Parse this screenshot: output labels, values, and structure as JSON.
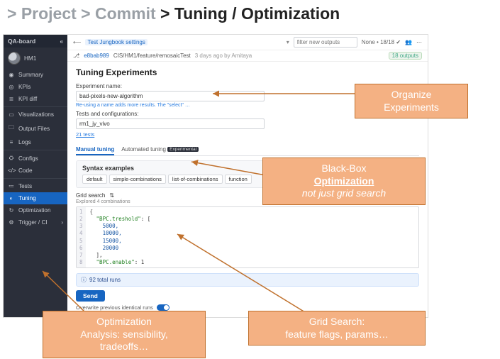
{
  "breadcrumb": {
    "dim": "> Project > Commit ",
    "strong": "> Tuning / Optimization"
  },
  "sidebar": {
    "brand": "QA-board",
    "project_label": "HM1",
    "items": [
      {
        "icon": "◉",
        "label": "Summary"
      },
      {
        "icon": "◎",
        "label": "KPIs"
      },
      {
        "icon": "≣",
        "label": "KPI diff"
      }
    ],
    "group2": [
      {
        "icon": "▭",
        "label": "Visualizations"
      },
      {
        "icon": "🗀",
        "label": "Output Files"
      },
      {
        "icon": "≡",
        "label": "Logs"
      }
    ],
    "group3": [
      {
        "icon": "⛭",
        "label": "Configs"
      },
      {
        "icon": "</>",
        "label": "Code"
      }
    ],
    "group4": [
      {
        "icon": "≔",
        "label": "Tests"
      },
      {
        "icon": "◐",
        "label": "Tuning"
      },
      {
        "icon": "↻",
        "label": "Optimization"
      },
      {
        "icon": "⚙",
        "label": "Trigger / CI"
      }
    ]
  },
  "topbar": {
    "prev_commit": "⟵",
    "jungbook": "Test Jungbook settings",
    "filter_placeholder": "filter new outputs",
    "status_counter": "None • 18/18 ✔",
    "commit_icon": "⎇",
    "commit_hash": "e8bab989",
    "commit_path": "CIS/HM1/feature/remosaicTest",
    "commit_meta": "3 days ago by Amitaya",
    "outputs_badge": "18 outputs"
  },
  "panel": {
    "title": "Tuning Experiments",
    "name_label": "Experiment name:",
    "name_value": "bad-pixels-new-algorithm",
    "name_hint": "Re-using a name adds more results. The \"select\" …",
    "tests_label": "Tests and configurations:",
    "tests_value": "rm1_jy_vivo",
    "tests_link": "21 tests",
    "tabs": {
      "manual": "Manual tuning",
      "automated": "Automated tuning",
      "badge": "Experimental"
    },
    "syntax": {
      "title": "Syntax examples",
      "buttons": [
        "default",
        "simple-combinations",
        "list-of-combinations",
        "function"
      ]
    },
    "gridsearch_label": "Grid search",
    "gridsearch_sort": "⇅",
    "explored": "Explored 4 combinations",
    "code": {
      "lines": [
        "1",
        "2",
        "3",
        "4",
        "5",
        "6",
        "7",
        "8"
      ],
      "l1": "{",
      "l2_key": "\"BPC.treshold\"",
      "l2_rest": ": [",
      "l3": "    5000,",
      "l4": "    10000,",
      "l5": "    15000,",
      "l6": "    20000",
      "l7": "  ],",
      "l8_key": "\"BPC.enable\"",
      "l8_rest": ": 1"
    },
    "alert": "92 total runs",
    "send": "Send",
    "overwrite": "Overwrite previous identical runs"
  },
  "callouts": {
    "organize_l1": "Organize",
    "organize_l2": "Experiments",
    "blackbox_l1": "Black-Box",
    "blackbox_l2": "Optimization",
    "blackbox_l3": "not just grid search",
    "gridsearch_l1": "Grid Search:",
    "gridsearch_l2": "feature  flags, params…",
    "optim_l1": "Optimization",
    "optim_l2": "Analysis: sensibility,",
    "optim_l3": "tradeoffs…"
  }
}
